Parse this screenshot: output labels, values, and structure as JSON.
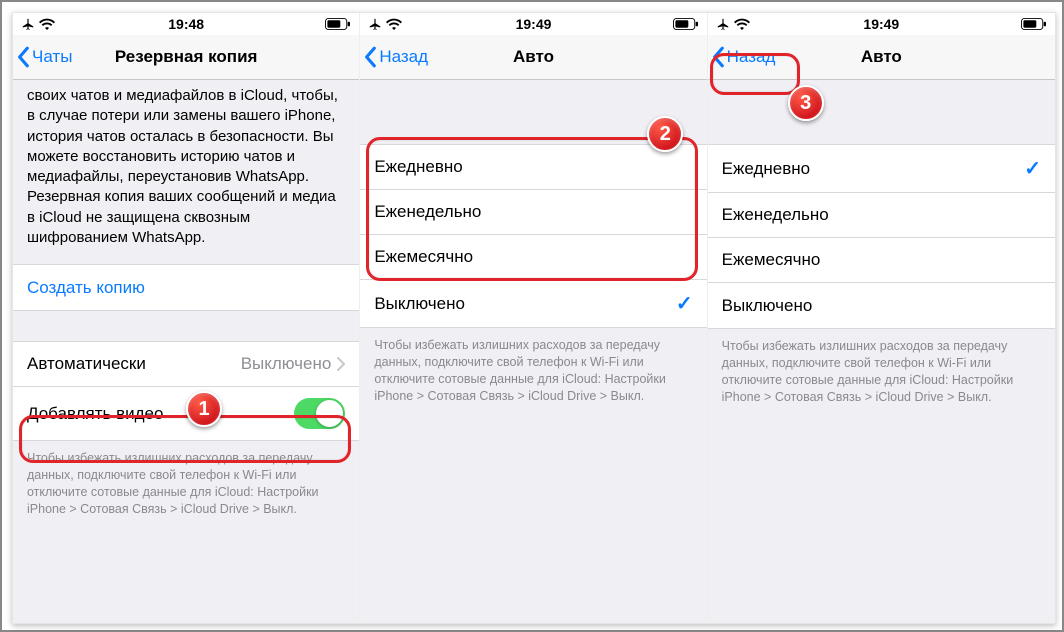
{
  "status": {
    "time_a": "19:48",
    "time_b": "19:49",
    "time_c": "19:49"
  },
  "screen1": {
    "nav_back": "Чаты",
    "nav_title": "Резервная копия",
    "paragraph": "своих чатов и медиафайлов в iCloud, чтобы, в случае потери или замены вашего iPhone, история чатов осталась в безопасности. Вы можете восстановить историю чатов и медиафайлы, переустановив WhatsApp. Резервная копия ваших сообщений и медиа в iCloud не защищена сквозным шифрованием WhatsApp.",
    "create_backup": "Создать копию",
    "auto_label": "Автоматически",
    "auto_value": "Выключено",
    "include_video": "Добавлять видео",
    "footer": "Чтобы избежать излишних расходов за передачу данных, подключите свой телефон к Wi-Fi или отключите сотовые данные для iCloud: Настройки iPhone > Сотовая Связь > iCloud Drive > Выкл."
  },
  "screen2": {
    "nav_back": "Назад",
    "nav_title": "Авто",
    "opt_daily": "Ежедневно",
    "opt_weekly": "Еженедельно",
    "opt_monthly": "Ежемесячно",
    "opt_off": "Выключено",
    "footer": "Чтобы избежать излишних расходов за передачу данных, подключите свой телефон к Wi-Fi или отключите сотовые данные для iCloud: Настройки iPhone > Сотовая Связь > iCloud Drive > Выкл."
  },
  "screen3": {
    "nav_back": "Назад",
    "nav_title": "Авто",
    "opt_daily": "Ежедневно",
    "opt_weekly": "Еженедельно",
    "opt_monthly": "Ежемесячно",
    "opt_off": "Выключено",
    "footer": "Чтобы избежать излишних расходов за передачу данных, подключите свой телефон к Wi-Fi или отключите сотовые данные для iCloud: Настройки iPhone > Сотовая Связь > iCloud Drive > Выкл."
  },
  "badges": {
    "one": "1",
    "two": "2",
    "three": "3"
  }
}
